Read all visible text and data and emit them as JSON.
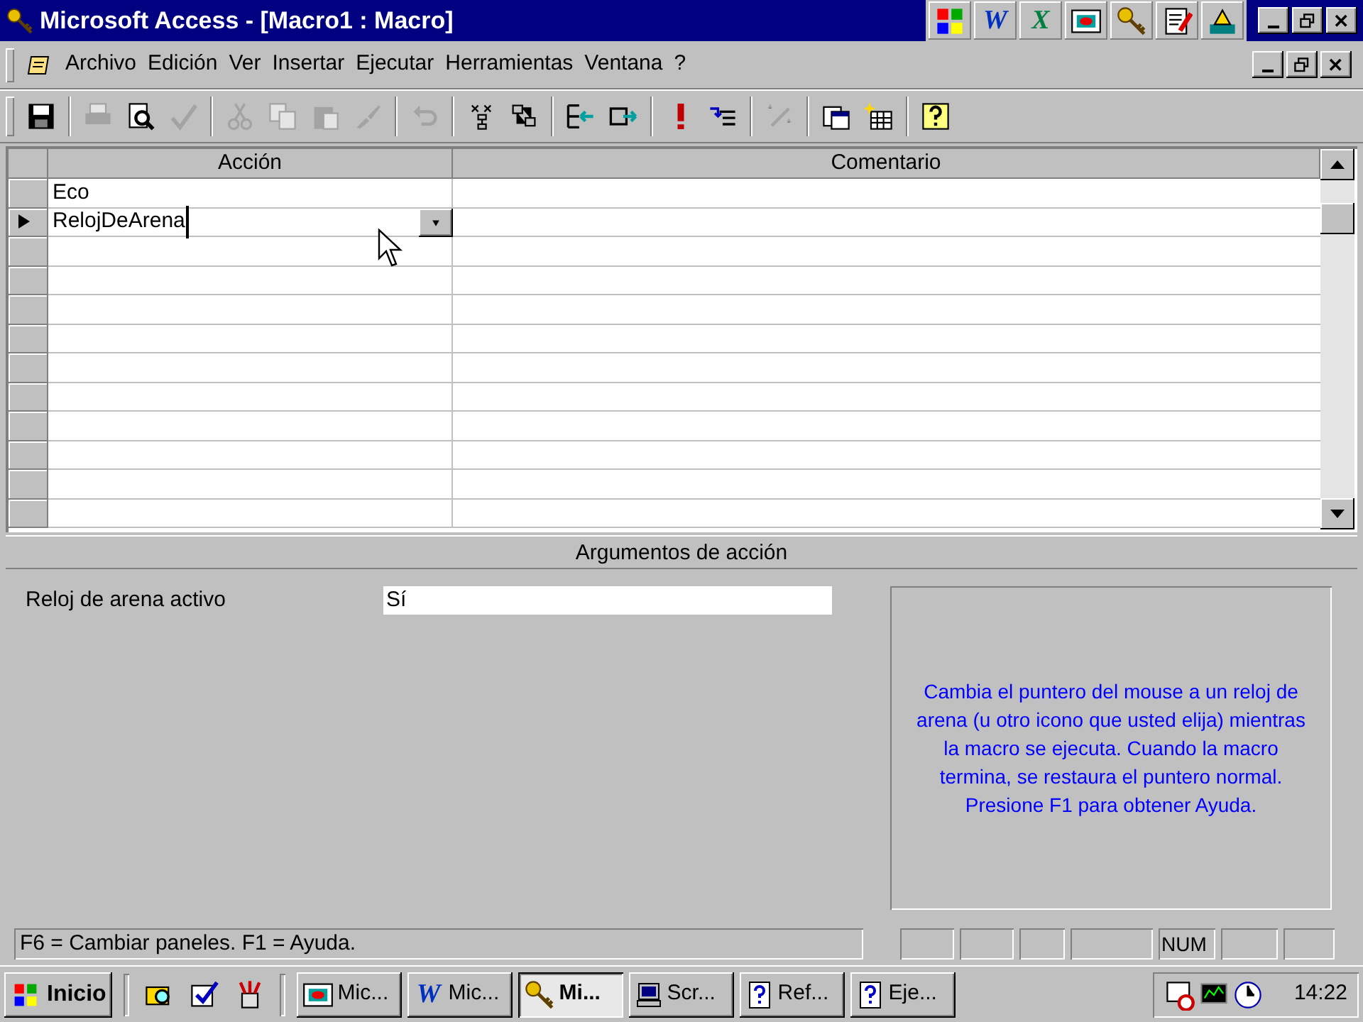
{
  "window": {
    "title": "Microsoft Access - [Macro1 : Macro]"
  },
  "office_bar": [
    {
      "kind": "grid"
    },
    {
      "kind": "word",
      "letter": "W"
    },
    {
      "kind": "excel",
      "letter": "X"
    },
    {
      "kind": "slide"
    },
    {
      "kind": "key"
    },
    {
      "kind": "notes"
    },
    {
      "kind": "setup"
    }
  ],
  "menu": [
    "Archivo",
    "Edición",
    "Ver",
    "Insertar",
    "Ejecutar",
    "Herramientas",
    "Ventana",
    "?"
  ],
  "toolbar": {
    "groups": [
      {
        "buttons": [
          {
            "kind": "save",
            "disabled": false
          }
        ]
      },
      {
        "buttons": [
          {
            "kind": "print",
            "disabled": true
          },
          {
            "kind": "preview",
            "disabled": false
          },
          {
            "kind": "spell",
            "disabled": true
          }
        ]
      },
      {
        "buttons": [
          {
            "kind": "cut",
            "disabled": true
          },
          {
            "kind": "copy",
            "disabled": true
          },
          {
            "kind": "paste",
            "disabled": true
          },
          {
            "kind": "brush",
            "disabled": true
          }
        ]
      },
      {
        "buttons": [
          {
            "kind": "undo",
            "disabled": true
          }
        ]
      },
      {
        "buttons": [
          {
            "kind": "names",
            "disabled": false
          },
          {
            "kind": "conditions",
            "disabled": false
          }
        ]
      },
      {
        "buttons": [
          {
            "kind": "insertrow",
            "disabled": false
          },
          {
            "kind": "deleterow",
            "disabled": false
          }
        ]
      },
      {
        "buttons": [
          {
            "kind": "run",
            "disabled": false
          },
          {
            "kind": "step",
            "disabled": false
          }
        ]
      },
      {
        "buttons": [
          {
            "kind": "build",
            "disabled": true
          }
        ]
      },
      {
        "buttons": [
          {
            "kind": "dbwindow",
            "disabled": false
          },
          {
            "kind": "newobject",
            "disabled": false
          }
        ]
      },
      {
        "buttons": [
          {
            "kind": "help",
            "disabled": false
          }
        ]
      }
    ]
  },
  "grid": {
    "columns": [
      "Acción",
      "Comentario"
    ],
    "rows": [
      {
        "action": "Eco",
        "selected": false
      },
      {
        "action": "RelojDeArena",
        "selected": true
      },
      {
        "selected": false
      },
      {
        "selected": false
      },
      {
        "selected": false
      },
      {
        "selected": false
      },
      {
        "selected": false
      },
      {
        "selected": false
      },
      {
        "selected": false
      },
      {
        "selected": false
      },
      {
        "selected": false
      },
      {
        "selected": false
      }
    ]
  },
  "arguments": {
    "title": "Argumentos de acción",
    "fields": [
      {
        "label": "Reloj de arena activo",
        "value": "Sí"
      }
    ],
    "help": "Cambia el puntero del mouse a un reloj de arena (u otro icono que usted elija) mientras la macro se ejecuta. Cuando la macro termina, se restaura el puntero normal. Presione F1 para obtener Ayuda."
  },
  "status_bar": {
    "message": "F6 = Cambiar paneles.  F1 = Ayuda.",
    "indicators": [
      "NUM"
    ]
  },
  "taskbar": {
    "start": "Inicio",
    "quick_launch": [
      {
        "kind": "explore"
      },
      {
        "kind": "check"
      },
      {
        "kind": "pens"
      }
    ],
    "buttons": [
      {
        "kind": "slide",
        "label": "Mic...",
        "selected": false
      },
      {
        "kind": "word",
        "letter": "W",
        "label": "Mic...",
        "selected": false
      },
      {
        "kind": "key",
        "label": "Mi...",
        "selected": true
      },
      {
        "kind": "computer",
        "label": "Scr...",
        "selected": false
      },
      {
        "kind": "help",
        "label": "Ref...",
        "selected": false
      },
      {
        "kind": "help",
        "label": "Eje...",
        "selected": false
      }
    ],
    "tray": {
      "time": "14:22"
    }
  }
}
